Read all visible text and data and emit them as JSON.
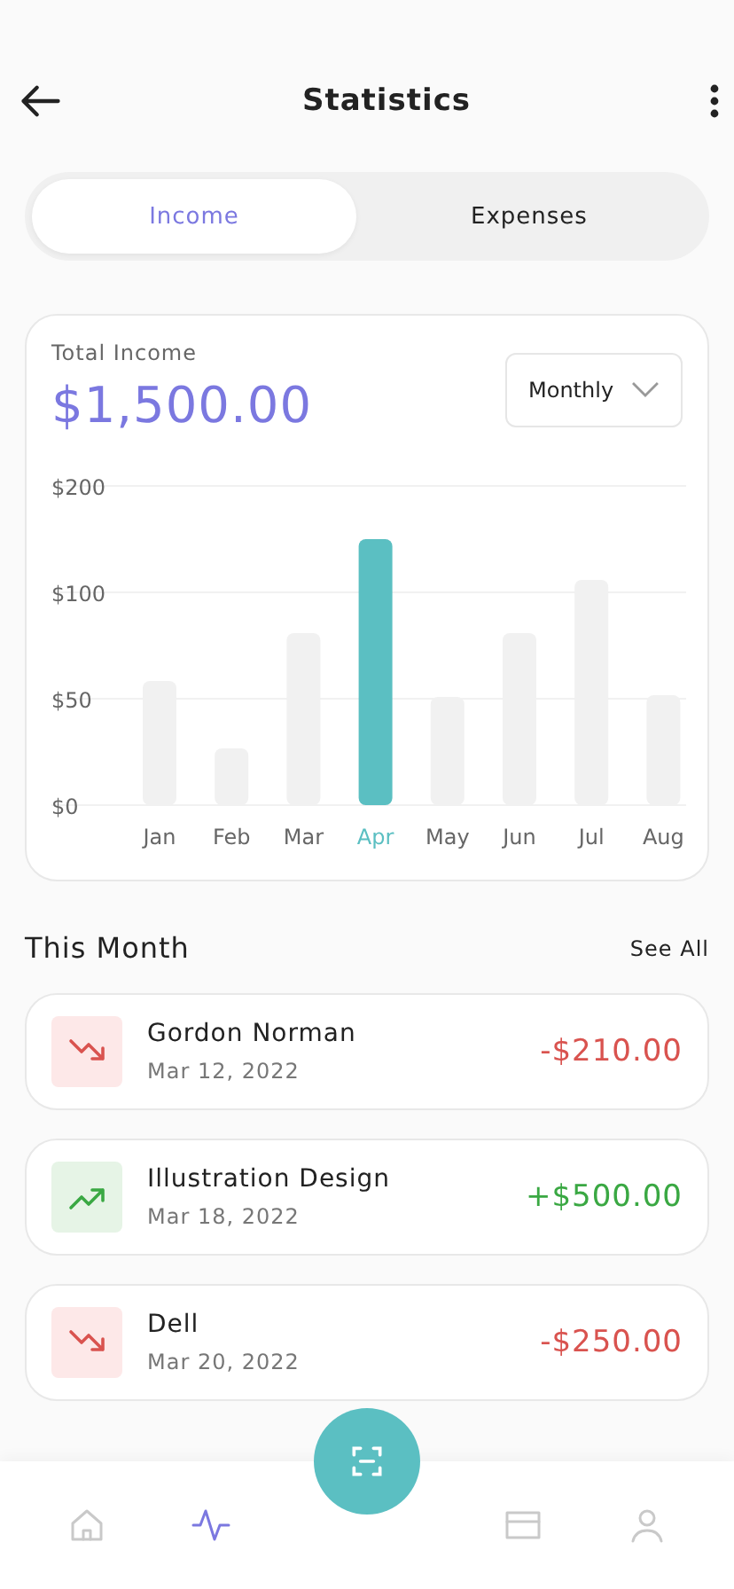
{
  "header": {
    "title": "Statistics"
  },
  "tabs": [
    {
      "label": "Income",
      "selected": true
    },
    {
      "label": "Expenses",
      "selected": false
    }
  ],
  "summary": {
    "label": "Total Income",
    "amount": "$1,500.00",
    "period": "Monthly"
  },
  "chart": {
    "y_labels": [
      "$200",
      "$100",
      "$50",
      "$0"
    ],
    "months": [
      {
        "label": "Jan",
        "selected": false
      },
      {
        "label": "Feb",
        "selected": false
      },
      {
        "label": "Mar",
        "selected": false
      },
      {
        "label": "Apr",
        "selected": true
      },
      {
        "label": "May",
        "selected": false
      },
      {
        "label": "Jun",
        "selected": false
      },
      {
        "label": "Jul",
        "selected": false
      },
      {
        "label": "Aug",
        "selected": false
      }
    ]
  },
  "section": {
    "title": "This Month",
    "action": "See All"
  },
  "transactions": [
    {
      "name": "Gordon Norman",
      "date": "Mar 12, 2022",
      "amount": "-$210.00",
      "kind": "debit"
    },
    {
      "name": "Illustration Design",
      "date": "Mar 18, 2022",
      "amount": "+$500.00",
      "kind": "credit"
    },
    {
      "name": "Dell",
      "date": "Mar 20, 2022",
      "amount": "-$250.00",
      "kind": "debit"
    }
  ],
  "nav": [
    {
      "kind": "home",
      "selected": false
    },
    {
      "kind": "activity",
      "selected": true
    },
    {
      "kind": "scan",
      "selected": false
    },
    {
      "kind": "card",
      "selected": false
    },
    {
      "kind": "user",
      "selected": false
    }
  ]
}
